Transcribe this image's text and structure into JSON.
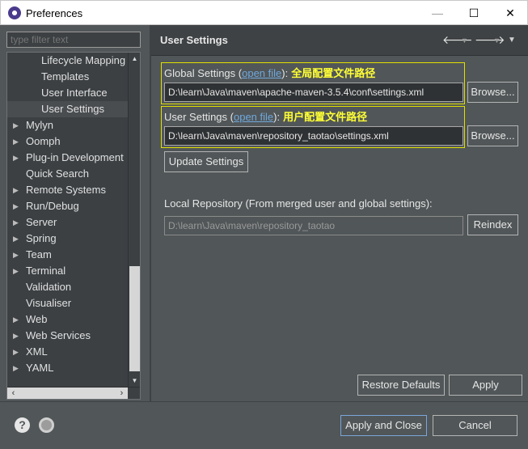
{
  "window": {
    "title": "Preferences",
    "minimize": "—",
    "maximize": "☐",
    "close": "✕"
  },
  "sidebar": {
    "filter_placeholder": "type filter text",
    "items": [
      {
        "label": "Lifecycle Mapping",
        "indent": 2,
        "expandable": false,
        "selected": false
      },
      {
        "label": "Templates",
        "indent": 2,
        "expandable": false,
        "selected": false
      },
      {
        "label": "User Interface",
        "indent": 2,
        "expandable": false,
        "selected": false
      },
      {
        "label": "User Settings",
        "indent": 2,
        "expandable": false,
        "selected": true
      },
      {
        "label": "Mylyn",
        "indent": 1,
        "expandable": true,
        "selected": false
      },
      {
        "label": "Oomph",
        "indent": 1,
        "expandable": true,
        "selected": false
      },
      {
        "label": "Plug-in Development",
        "indent": 1,
        "expandable": true,
        "selected": false
      },
      {
        "label": "Quick Search",
        "indent": 1,
        "expandable": false,
        "selected": false
      },
      {
        "label": "Remote Systems",
        "indent": 1,
        "expandable": true,
        "selected": false
      },
      {
        "label": "Run/Debug",
        "indent": 1,
        "expandable": true,
        "selected": false
      },
      {
        "label": "Server",
        "indent": 1,
        "expandable": true,
        "selected": false
      },
      {
        "label": "Spring",
        "indent": 1,
        "expandable": true,
        "selected": false
      },
      {
        "label": "Team",
        "indent": 1,
        "expandable": true,
        "selected": false
      },
      {
        "label": "Terminal",
        "indent": 1,
        "expandable": true,
        "selected": false
      },
      {
        "label": "Validation",
        "indent": 1,
        "expandable": false,
        "selected": false
      },
      {
        "label": "Visualiser",
        "indent": 1,
        "expandable": false,
        "selected": false
      },
      {
        "label": "Web",
        "indent": 1,
        "expandable": true,
        "selected": false
      },
      {
        "label": "Web Services",
        "indent": 1,
        "expandable": true,
        "selected": false
      },
      {
        "label": "XML",
        "indent": 1,
        "expandable": true,
        "selected": false
      },
      {
        "label": "YAML",
        "indent": 1,
        "expandable": true,
        "selected": false
      }
    ]
  },
  "page": {
    "title": "User Settings",
    "global": {
      "label": "Global Settings (",
      "link": "open file",
      "label_end": "):",
      "annotation": "全局配置文件路径",
      "path": "D:\\learn\\Java\\maven\\apache-maven-3.5.4\\conf\\settings.xml",
      "browse": "Browse..."
    },
    "user": {
      "label": "User Settings (",
      "link": "open file",
      "label_end": "):",
      "annotation": "用户配置文件路径",
      "path": "D:\\learn\\Java\\maven\\repository_taotao\\settings.xml",
      "browse": "Browse..."
    },
    "update_button": "Update Settings",
    "local_repo": {
      "label": "Local Repository (From merged user and global settings):",
      "path": "D:\\learn\\Java\\maven\\repository_taotao",
      "reindex": "Reindex"
    },
    "restore_defaults": "Restore Defaults",
    "apply": "Apply"
  },
  "footer": {
    "help_icon": "?",
    "apply_and_close": "Apply and Close",
    "cancel": "Cancel"
  },
  "colors": {
    "background": "#515658",
    "field": "#2f3234",
    "annotation": "#ffff33",
    "highlight_border": "#e0e000",
    "link": "#6fa8dc"
  }
}
